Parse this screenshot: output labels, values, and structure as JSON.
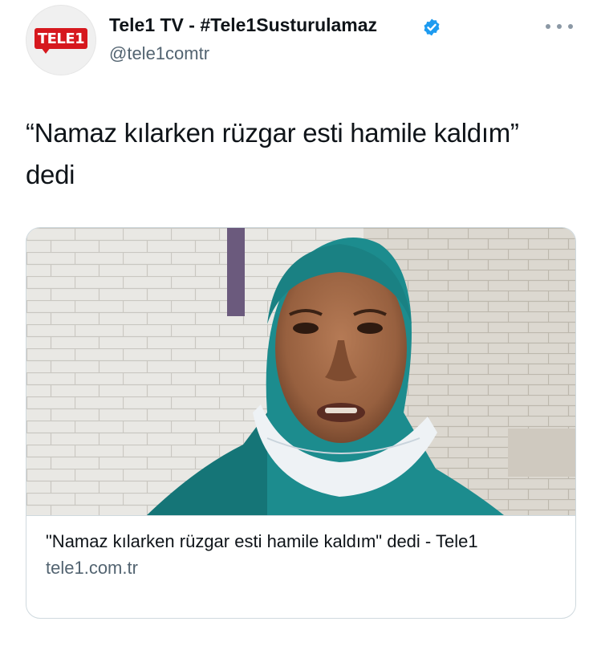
{
  "account": {
    "logo_text": "TELE1",
    "display_name": "Tele1 TV - #Tele1Susturulamaz",
    "handle": "@tele1comtr"
  },
  "icons": {
    "verified": "verified-badge-icon",
    "more": "more-options-icon"
  },
  "tweet": {
    "text": "“Namaz kılarken rüzgar esti hamile kaldım” dedi"
  },
  "card": {
    "title": "\"Namaz kılarken rüzgar esti hamile kaldım\" dedi - Tele1",
    "domain": "tele1.com.tr"
  },
  "colors": {
    "verified": "#1d9bf0",
    "brand_red": "#d6181e",
    "hijab": "#1c8c8e"
  }
}
